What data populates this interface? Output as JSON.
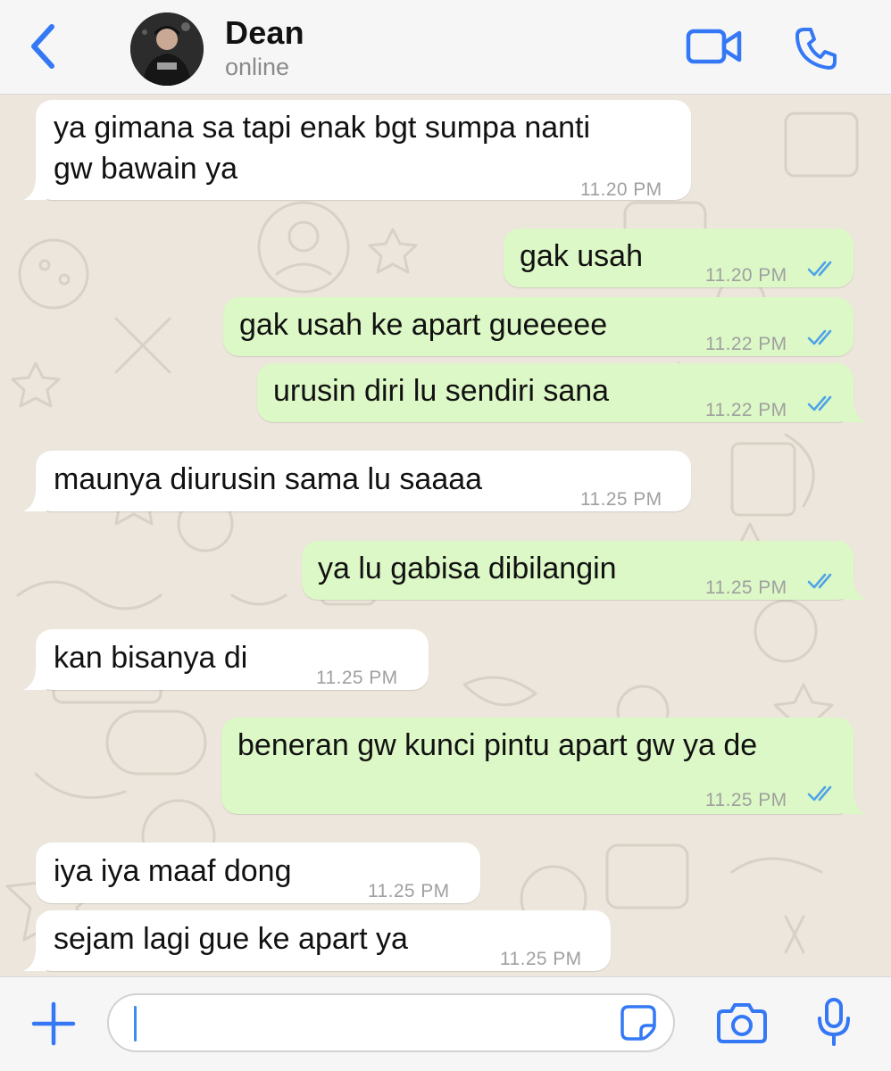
{
  "header": {
    "contact_name": "Dean",
    "status": "online",
    "back_icon": "chevron-left-icon",
    "video_icon": "video-camera-icon",
    "phone_icon": "phone-icon"
  },
  "messages": [
    {
      "direction": "incoming",
      "lines": [
        "ya gimana sa tapi enak bgt sumpa nanti",
        "gw bawain ya"
      ],
      "time": "11.20 PM"
    },
    {
      "direction": "outgoing",
      "lines": [
        "gak usah"
      ],
      "time": "11.20 PM",
      "status": "read"
    },
    {
      "direction": "outgoing",
      "lines": [
        "gak usah ke apart gueeeee"
      ],
      "time": "11.22 PM",
      "status": "read"
    },
    {
      "direction": "outgoing",
      "lines": [
        "urusin diri lu sendiri sana"
      ],
      "time": "11.22 PM",
      "status": "read"
    },
    {
      "direction": "incoming",
      "lines": [
        "maunya diurusin sama lu saaaa"
      ],
      "time": "11.25 PM"
    },
    {
      "direction": "outgoing",
      "lines": [
        "ya lu gabisa dibilangin"
      ],
      "time": "11.25 PM",
      "status": "read"
    },
    {
      "direction": "incoming",
      "lines": [
        "kan bisanya di"
      ],
      "time": "11.25 PM"
    },
    {
      "direction": "outgoing",
      "lines": [
        "beneran gw kunci pintu apart gw ya de"
      ],
      "time": "11.25 PM",
      "status": "read"
    },
    {
      "direction": "incoming",
      "lines": [
        "iya iya maaf dong"
      ],
      "time": "11.25 PM"
    },
    {
      "direction": "incoming",
      "lines": [
        "sejam lagi gue ke apart ya"
      ],
      "time": "11.25 PM"
    }
  ],
  "input_bar": {
    "message_value": "",
    "placeholder": "",
    "plus_icon": "plus-icon",
    "sticker_icon": "sticker-icon",
    "camera_icon": "camera-icon",
    "mic_icon": "microphone-icon"
  },
  "colors": {
    "accent": "#3478f6",
    "incoming_bubble": "#ffffff",
    "outgoing_bubble": "#dcf8c6",
    "read_ticks": "#4fa3e8",
    "chat_background": "#ece6dc"
  }
}
